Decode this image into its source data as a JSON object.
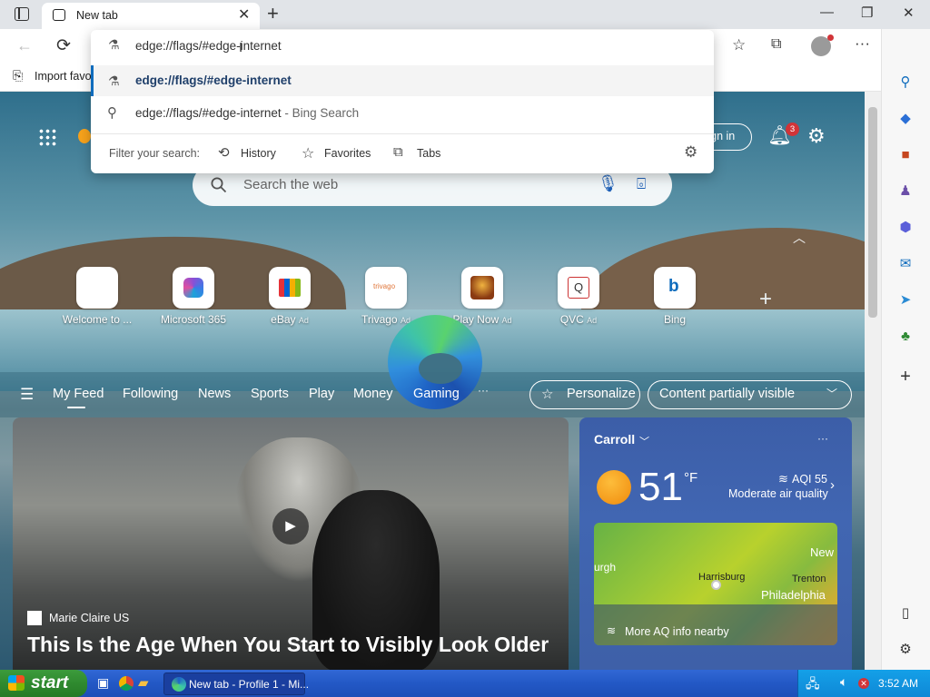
{
  "tab": {
    "title": "New tab"
  },
  "window": {
    "minimize": "—",
    "restore": "❐",
    "close": "✕"
  },
  "address": {
    "value": "edge://flags/#edge-internet"
  },
  "suggestions": [
    {
      "text": "edge://flags/#edge-internet",
      "suffix": ""
    },
    {
      "text": "edge://flags/#edge-internet",
      "suffix": " - Bing Search"
    }
  ],
  "filter": {
    "label": "Filter your search:",
    "history": "History",
    "favorites": "Favorites",
    "tabs": "Tabs"
  },
  "favbar": {
    "import": "Import favo"
  },
  "header": {
    "signin": "Sign in",
    "notifications": "3"
  },
  "search": {
    "placeholder": "Search the web"
  },
  "tiles": [
    {
      "label": "Welcome to ...",
      "ad": ""
    },
    {
      "label": "Microsoft 365",
      "ad": ""
    },
    {
      "label": "eBay",
      "ad": "Ad"
    },
    {
      "label": "Trivago",
      "ad": "Ad"
    },
    {
      "label": "Play Now",
      "ad": "Ad"
    },
    {
      "label": "QVC",
      "ad": "Ad"
    },
    {
      "label": "Bing",
      "ad": ""
    }
  ],
  "tiles_trivago_text": "trivago",
  "feed": {
    "tabs": [
      "My Feed",
      "Following",
      "News",
      "Sports",
      "Play",
      "Money",
      "Gaming"
    ],
    "more": "···",
    "personalize": "Personalize",
    "visibility": "Content partially visible"
  },
  "article": {
    "source": "Marie Claire US",
    "headline": "This Is the Age When You Start to Visibly Look Older"
  },
  "weather": {
    "location": "Carroll",
    "temp": "51",
    "unit": "°F",
    "aqi": "AQI 55",
    "aqi_desc": "Moderate air quality",
    "map_labels": {
      "harrisburg": "Harrisburg",
      "trenton": "Trenton",
      "philadelphia": "Philadelphia",
      "new": "New",
      "pittsburgh": "urgh"
    },
    "more": "More AQ info nearby",
    "menu": "···"
  },
  "taskbar": {
    "start": "start",
    "window_item": "New tab - Profile 1 - Mi...",
    "clock": "3:52 AM"
  },
  "colors": {
    "accent": "#0f6cbd",
    "taskbar": "#245edb",
    "start": "#3a9a3a",
    "notif": "#d13438"
  }
}
